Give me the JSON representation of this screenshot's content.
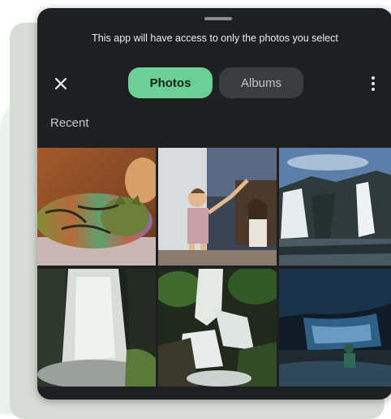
{
  "banner": {
    "text": "This app will have access to only the photos you select"
  },
  "toolbar": {
    "tabs": [
      {
        "label": "Photos",
        "active": true
      },
      {
        "label": "Albums",
        "active": false
      }
    ]
  },
  "section": {
    "label": "Recent"
  },
  "photos": [
    {
      "subject": "sleeping tabby cat"
    },
    {
      "subject": "children playing"
    },
    {
      "subject": "waterfall"
    },
    {
      "subject": "waterfall"
    },
    {
      "subject": "waterfall"
    },
    {
      "subject": "waterfall"
    }
  ],
  "colors": {
    "accent": "#6bcf96",
    "sheet_bg": "#1d1f21"
  }
}
